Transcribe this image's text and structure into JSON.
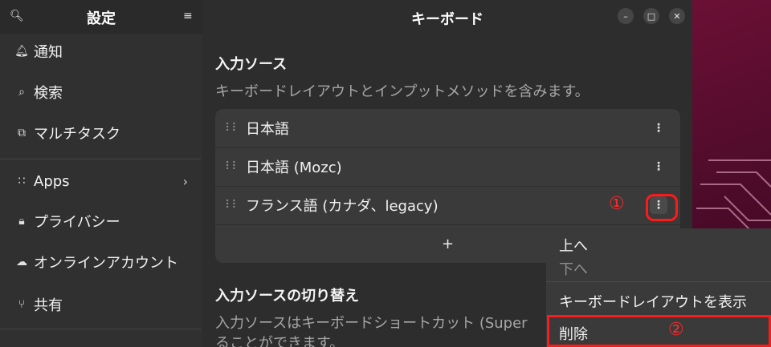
{
  "sidebar": {
    "title": "設定",
    "items": [
      {
        "label": "通知",
        "icon": "bell-icon"
      },
      {
        "label": "検索",
        "icon": "search-icon"
      },
      {
        "label": "マルチタスク",
        "icon": "multitasking-icon"
      },
      {
        "label": "Apps",
        "icon": "apps-grid-icon"
      },
      {
        "label": "プライバシー",
        "icon": "lock-icon"
      },
      {
        "label": "オンラインアカウント",
        "icon": "cloud-icon"
      },
      {
        "label": "共有",
        "icon": "share-icon"
      }
    ]
  },
  "header": {
    "title": "キーボード"
  },
  "input_sources": {
    "title": "入力ソース",
    "description": "キーボードレイアウトとインプットメソッドを含みます。",
    "items": [
      {
        "name": "日本語"
      },
      {
        "name": "日本語 (Mozc)"
      },
      {
        "name": "フランス語 (カナダ、legacy)"
      }
    ],
    "add_label": "+"
  },
  "switching": {
    "title": "入力ソースの切り替え",
    "description_line1": "入力ソースはキーボードショートカット (Super",
    "description_line2": "ることができます。"
  },
  "context_menu": {
    "move_up": "上へ",
    "move_down": "下へ",
    "show_layout": "キーボードレイアウトを表示",
    "remove": "削除"
  },
  "annotations": {
    "step1": "①",
    "step2": "②",
    "color": "#ff1a1a"
  }
}
